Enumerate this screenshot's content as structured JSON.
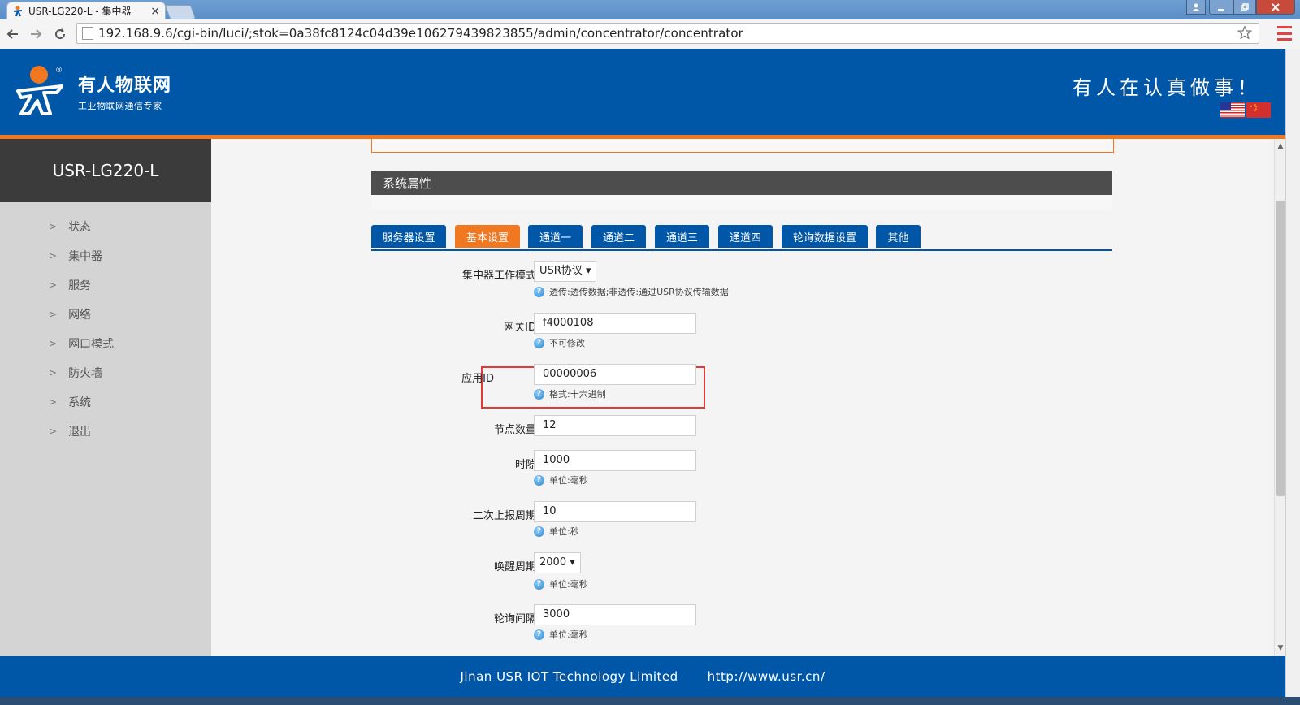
{
  "browser": {
    "tab_title": "USR-LG220-L - 集中器",
    "tab_close": "×",
    "url": "192.168.9.6/cgi-bin/luci/;stok=0a38fc8124c04d39e106279439823855/admin/concentrator/concentrator"
  },
  "header": {
    "brand_name": "有人物联网",
    "brand_sub": "工业物联网通信专家",
    "slogan": "有人在认真做事！"
  },
  "sidebar": {
    "device": "USR-LG220-L",
    "items": [
      {
        "label": "状态"
      },
      {
        "label": "集中器"
      },
      {
        "label": "服务"
      },
      {
        "label": "网络"
      },
      {
        "label": "网口模式"
      },
      {
        "label": "防火墙"
      },
      {
        "label": "系统"
      },
      {
        "label": "退出"
      }
    ]
  },
  "main": {
    "section_title": "系统属性",
    "tabs": [
      {
        "label": "服务器设置"
      },
      {
        "label": "基本设置",
        "active": true
      },
      {
        "label": "通道一"
      },
      {
        "label": "通道二"
      },
      {
        "label": "通道三"
      },
      {
        "label": "通道四"
      },
      {
        "label": "轮询数据设置"
      },
      {
        "label": "其他"
      }
    ],
    "fields": {
      "mode": {
        "label": "集中器工作模式",
        "value": "USR协议",
        "hint": "透传:透传数据;非透传:通过USR协议传输数据"
      },
      "gateway_id": {
        "label": "网关ID",
        "value": "f4000108",
        "hint": "不可修改"
      },
      "app_id": {
        "label": "应用ID",
        "value": "00000006",
        "hint": "格式:十六进制"
      },
      "node_count": {
        "label": "节点数量",
        "value": "12"
      },
      "time_slot": {
        "label": "时隙",
        "value": "1000",
        "hint": "单位:毫秒"
      },
      "report_period": {
        "label": "二次上报周期",
        "value": "10",
        "hint": "单位:秒"
      },
      "wake_period": {
        "label": "唤醒周期",
        "value": "2000",
        "hint": "单位:毫秒"
      },
      "poll_interval": {
        "label": "轮询间隔",
        "value": "3000",
        "hint": "单位:毫秒"
      }
    }
  },
  "footer": {
    "company": "Jinan USR IOT Technology Limited",
    "website": "http://www.usr.cn/"
  },
  "colors": {
    "brand_blue": "#0057a8",
    "accent_orange": "#f07820",
    "highlight_red": "#e53935"
  }
}
